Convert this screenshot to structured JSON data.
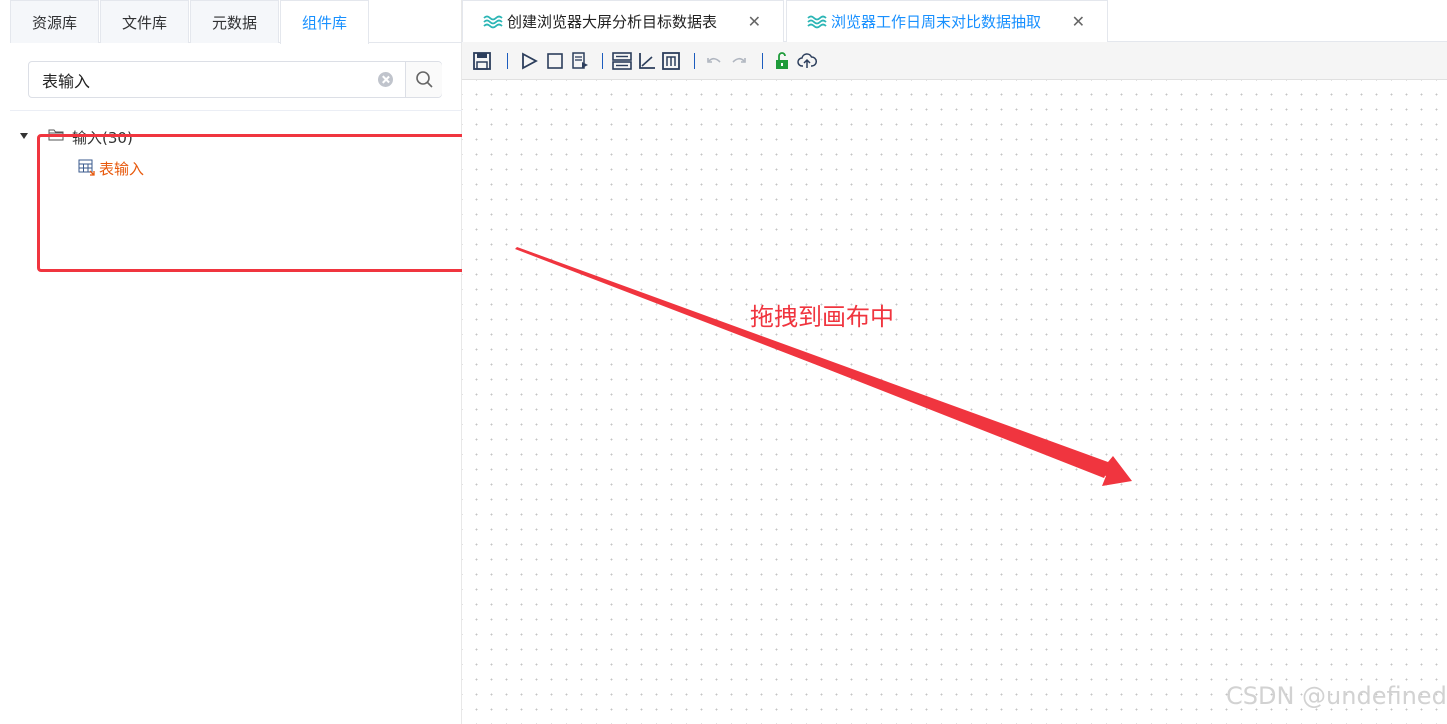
{
  "left_tabs": [
    {
      "label": "资源库"
    },
    {
      "label": "文件库"
    },
    {
      "label": "元数据"
    },
    {
      "label": "组件库"
    }
  ],
  "search": {
    "value": "表输入"
  },
  "tree": {
    "folder_label": "输入(30)",
    "leaf_label": "表输入"
  },
  "file_tabs": [
    {
      "label": "创建浏览器大屏分析目标数据表"
    },
    {
      "label": "浏览器工作日周末对比数据抽取"
    }
  ],
  "toolbar_icons": [
    "save-icon",
    "run-icon",
    "stop-icon",
    "preview-icon",
    "layout-icon",
    "align-icon",
    "metrics-icon",
    "undo-icon",
    "redo-icon",
    "lock-icon",
    "upload-icon"
  ],
  "annotation": {
    "text": "拖拽到画布中"
  },
  "watermark": "CSDN @undefined",
  "colors": {
    "accent": "#1890ff",
    "annotation": "#f0353f",
    "leaf": "#e8590c"
  }
}
